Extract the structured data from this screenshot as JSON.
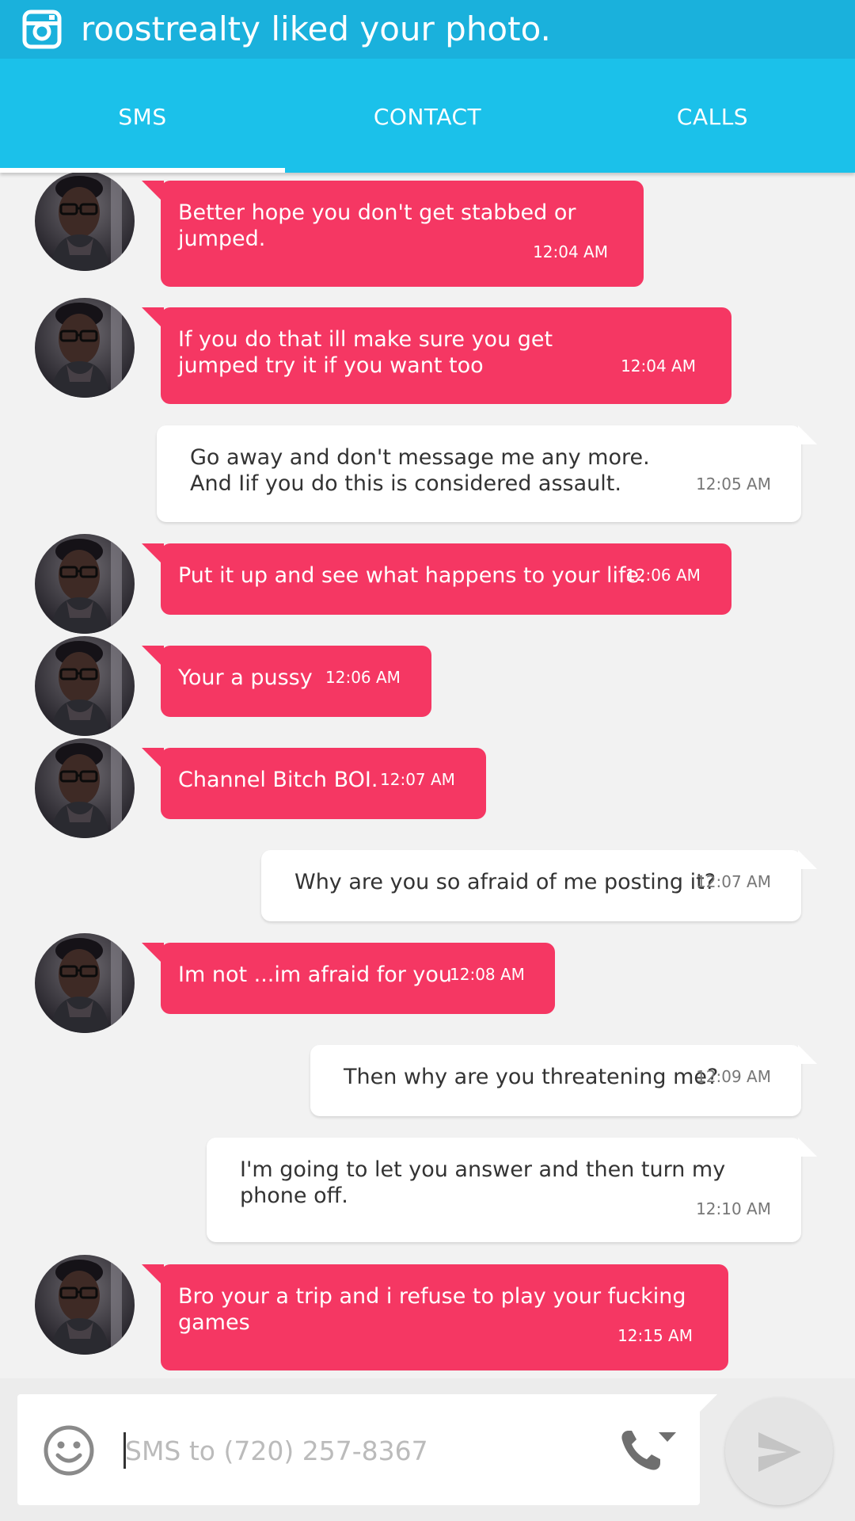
{
  "notification": {
    "text": "roostrealty liked your photo.",
    "icon": "instagram-icon"
  },
  "tabs": [
    {
      "label": "SMS",
      "active": true
    },
    {
      "label": "CONTACT",
      "active": false
    },
    {
      "label": "CALLS",
      "active": false
    }
  ],
  "messages": [
    {
      "dir": "in",
      "text": "Better hope you don't get stabbed or jumped.",
      "time": "12:04 AM"
    },
    {
      "dir": "in",
      "text": "If you do that ill make sure you get jumped try it if you want too",
      "time": "12:04 AM"
    },
    {
      "dir": "out",
      "text": "Go away and don't message me any more. And Iif you do this is considered assault.",
      "time": "12:05 AM"
    },
    {
      "dir": "in",
      "text": "Put it up and see what happens to your life.",
      "time": "12:06 AM"
    },
    {
      "dir": "in",
      "text": "Your a pussy",
      "time": "12:06 AM"
    },
    {
      "dir": "in",
      "text": "Channel Bitch BOI.",
      "time": "12:07 AM"
    },
    {
      "dir": "out",
      "text": "Why are you so afraid of me posting it?",
      "time": "12:07 AM"
    },
    {
      "dir": "in",
      "text": "Im not ...im afraid for you",
      "time": "12:08 AM"
    },
    {
      "dir": "out",
      "text": "Then why are you threatening me?",
      "time": "12:09 AM"
    },
    {
      "dir": "out",
      "text": "I'm going to let you answer and then turn my phone off.",
      "time": "12:10 AM"
    },
    {
      "dir": "in",
      "text": "Bro your a trip and i refuse to play your fucking games",
      "time": "12:15 AM"
    }
  ],
  "composer": {
    "placeholder": "SMS to (720) 257-8367",
    "emoji_icon": "smiley-icon",
    "call_icon": "phone-dropdown-icon",
    "send_icon": "send-icon"
  },
  "colors": {
    "status_bar": "#1ab1dc",
    "tab_bar": "#1bc1ea",
    "incoming_bubble": "#f53763",
    "outgoing_bubble": "#ffffff",
    "background": "#f2f2f2"
  }
}
